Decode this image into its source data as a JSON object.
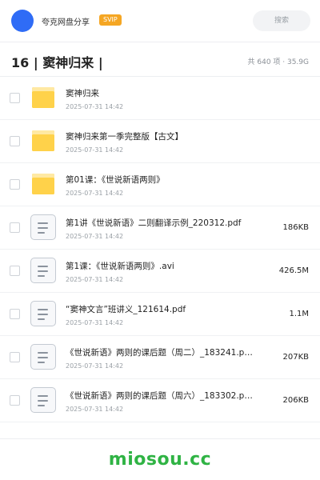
{
  "header": {
    "account_name": "夸克网盘分享",
    "badge": "SVIP",
    "search_placeholder": "搜索"
  },
  "title": {
    "text": "16 | 窦神归来 |",
    "summary": "共 640 项 · 35.9G"
  },
  "files": [
    {
      "name": "窦神归来",
      "date": "2025-07-31 14:42",
      "size": "",
      "type": "folder"
    },
    {
      "name": "窦神归来第一季完整版【古文】",
      "date": "2025-07-31 14:42",
      "size": "",
      "type": "folder"
    },
    {
      "name": "第01课：《世说新语两则》",
      "date": "2025-07-31 14:42",
      "size": "",
      "type": "folder"
    },
    {
      "name": "第1讲《世说新语》二则翻译示例_220312.pdf",
      "date": "2025-07-31 14:42",
      "size": "186KB",
      "type": "file"
    },
    {
      "name": "第1课：《世说新语两则》.avi",
      "date": "2025-07-31 14:42",
      "size": "426.5M",
      "type": "file"
    },
    {
      "name": "“窦神文言”班讲义_121614.pdf",
      "date": "2025-07-31 14:42",
      "size": "1.1M",
      "type": "file"
    },
    {
      "name": "《世说新语》两则的课后题（周二）_183241.p…",
      "date": "2025-07-31 14:42",
      "size": "207KB",
      "type": "file"
    },
    {
      "name": "《世说新语》两则的课后题（周六）_183302.p…",
      "date": "2025-07-31 14:42",
      "size": "206KB",
      "type": "file"
    }
  ],
  "watermark": "miosou.cc",
  "colors": {
    "avatar": "#2f6cf6",
    "badge": "#f5a623",
    "folder": "#ffd24a",
    "watermark": "#2fb344"
  },
  "icons": {
    "folder": "folder-icon",
    "file": "document-icon"
  }
}
